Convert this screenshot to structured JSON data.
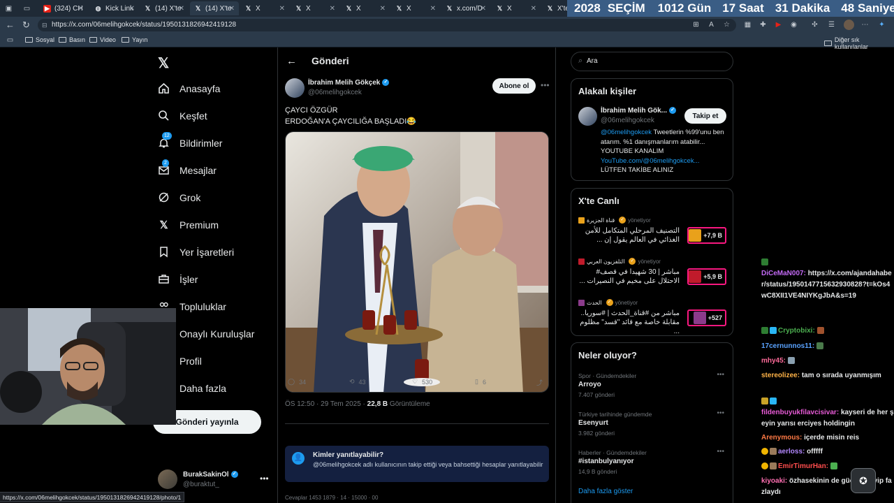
{
  "browser": {
    "tabs": [
      {
        "label": "(324) CH",
        "icon": "youtube-icon"
      },
      {
        "label": "Kick Link",
        "icon": "globe-icon"
      },
      {
        "label": "(14) X'te",
        "icon": "x-icon"
      },
      {
        "label": "(14) X'te",
        "icon": "x-icon"
      },
      {
        "label": "X",
        "icon": "x-icon"
      },
      {
        "label": "X",
        "icon": "x-icon"
      },
      {
        "label": "X",
        "icon": "x-icon"
      },
      {
        "label": "X",
        "icon": "x-icon"
      },
      {
        "label": "x.com/D",
        "icon": "x-icon"
      },
      {
        "label": "X",
        "icon": "x-icon"
      },
      {
        "label": "X'te",
        "icon": "x-icon"
      }
    ],
    "countdown": {
      "year": "2028",
      "label": "SEÇİM",
      "days": "1012",
      "days_label": "Gün",
      "hours": "17",
      "hours_label": "Saat",
      "minutes": "31",
      "minutes_label": "Dakika",
      "seconds": "48",
      "seconds_label": "Saniye"
    },
    "url": "https://x.com/06melihgokcek/status/1950131826942419128",
    "bookmarks": [
      "Sosyal",
      "Basın",
      "Video",
      "Yayın"
    ],
    "other_bookmarks": "Diğer sık kullanılanlar",
    "status_url": "https://x.com/06melihgokcek/status/1950131826942419128/photo/1"
  },
  "nav": {
    "items": [
      "Anasayfa",
      "Keşfet",
      "Bildirimler",
      "Mesajlar",
      "Grok",
      "Premium",
      "Yer İşaretleri",
      "İşler",
      "Topluluklar",
      "Onaylı Kuruluşlar",
      "Profil",
      "Daha fazla"
    ],
    "notif_badge": "12",
    "msg_badge": "2",
    "post_button": "Gönderi yayınla",
    "account": {
      "name": "BurakSakinOl",
      "handle": "@buraktut_"
    }
  },
  "post": {
    "header": "Gönderi",
    "author": "İbrahim Melih Gökçek",
    "handle": "@06melihgokcek",
    "subscribe": "Abone ol",
    "text_line1": "ÇAYCI ÖZGÜR",
    "text_line2": "ERDOĞAN'A ÇAYCILIĞA BAŞLADI😂",
    "time": "ÖS 12:50 · 29 Tem 2025 ·",
    "views": "22,8 B",
    "views_label": "Görüntüleme",
    "replies": "34",
    "reposts": "43",
    "likes": "530",
    "bookmarks": "6",
    "who_reply_title": "Kimler yanıtlayabilir?",
    "who_reply_desc": "@06melihgokcek adlı kullanıcının takip ettiği veya bahsettiği hesaplar yanıtlayabilir",
    "next_row": "Cevaplar  1453   1879  ·  14  ·  15000  ·  00"
  },
  "sidebar": {
    "search_placeholder": "Ara",
    "related_title": "Alakalı kişiler",
    "related": {
      "name": "İbrahim Melih Gök...",
      "handle": "@06melihgokcek",
      "follow": "Takip et",
      "bio_link": "@06melihgokcek",
      "bio1": " Tweetlerin %99'unu ben atarım. %1 danışmanlarım atabilir...",
      "bio2": "YOUTUBE KANALIM",
      "bio_link2": "YouTube.com/@06melihgokcek...",
      "bio3": "LÜTFEN TAKİBE ALINIZ"
    },
    "live_title": "X'te Canlı",
    "live": [
      {
        "source": "قناة الجزيرة",
        "status": "yönetiyor",
        "title": "التصنيف المرحلي المتكامل للأمن الغذائي في العالم يقول إن ...",
        "count": "+7,9 B",
        "color": "#e9a11b"
      },
      {
        "source": "التلفزيون العربي",
        "status": "yönetiyor",
        "title": "مباشر | 30 شهيدا في قصف# الاحتلال على مخيم في النصيرات ...",
        "count": "+5,9 B",
        "color": "#c01b2b"
      },
      {
        "source": "الحدث",
        "status": "yönetiyor",
        "title": "مباشر من #قناة_الحدث | #سوريا.. مقابلة خاصة مع قائد \"قسد\" مظلوم ...",
        "count": "+527",
        "color": "#8b3b8b"
      }
    ],
    "trends_title": "Neler oluyor?",
    "trends": [
      {
        "category": "Spor · Gündemdekiler",
        "name": "Arroyo",
        "count": "7.407 gönderi"
      },
      {
        "category": "Türkiye tarihinde gündemde",
        "name": "Esenyurt",
        "count": "3.982 gönderi"
      },
      {
        "category": "Haberler · Gündemdekiler",
        "name": "#istanbulyanıyor",
        "count": "14,9 B gönderi"
      }
    ],
    "show_more": "Daha fazla göster"
  },
  "chat": [
    {
      "user": "DiCeMaN007:",
      "color": "#c36af5",
      "msg": "https://x.com/ajandahaber/status/1950147715632930828?t=kOs4wC8XII1VE4NIYKgJbA&s=19"
    },
    {
      "user": "Cryptobixi:",
      "color": "#4caf50",
      "msg": ""
    },
    {
      "user": "17cernunnos11:",
      "color": "#5aa3ff",
      "msg": ""
    },
    {
      "user": "mhy45:",
      "color": "#ff6b9a",
      "msg": ""
    },
    {
      "user": "stereolizee:",
      "color": "#ffb347",
      "msg": "tam o sırada uyanmışım"
    },
    {
      "user": "fildenbuyukfilavcisivar:",
      "color": "#e85bd7",
      "msg": "kayseri de her şeyin yarısı erciyes holdingin"
    },
    {
      "user": "Arenymous:",
      "color": "#ff7a45",
      "msg": "içerde misin reis"
    },
    {
      "user": "aerloss:",
      "color": "#b388ff",
      "msg": "offfff"
    },
    {
      "user": "EmirTimurHan:",
      "color": "#ff4d4d",
      "msg": ""
    },
    {
      "user": "kiyoaki:",
      "color": "#ff6fb1",
      "msg": "özhasekinin de güçlü acayip fazlaydı"
    }
  ]
}
